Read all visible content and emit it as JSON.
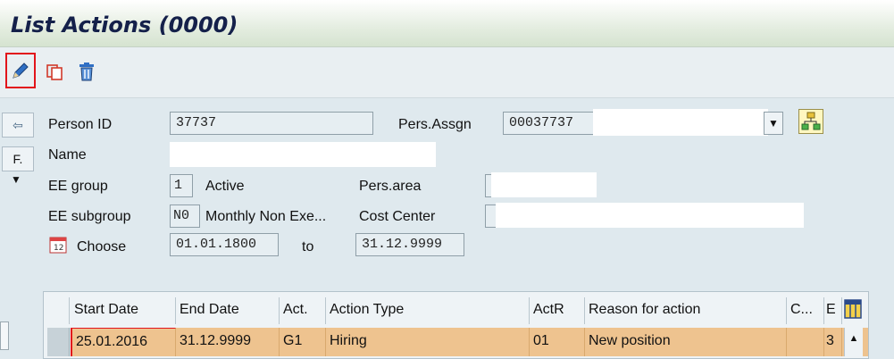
{
  "title": "List Actions (0000)",
  "toolbar": {
    "edit_icon": "pencil-icon",
    "copy_icon": "copy-icon",
    "delete_icon": "trash-icon"
  },
  "left_strip": {
    "back_icon": "back-arrow-icon",
    "f_label": "F.",
    "dropdown_icon": "triangle-down-icon"
  },
  "form": {
    "person_id_label": "Person ID",
    "person_id_value": "37737",
    "pers_assgn_label": "Pers.Assgn",
    "pers_assgn_value": "00037737",
    "name_label": "Name",
    "ee_group_label": "EE group",
    "ee_group_value": "1",
    "ee_group_text": "Active",
    "pers_area_label": "Pers.area",
    "ee_subgroup_label": "EE subgroup",
    "ee_subgroup_value": "N0",
    "ee_subgroup_text": "Monthly Non Exe...",
    "cost_center_label": "Cost Center",
    "choose_label": "Choose",
    "from_date": "01.01.1800",
    "to_label": "to",
    "to_date": "31.12.9999"
  },
  "table": {
    "columns": [
      "Start Date",
      "End Date",
      "Act.",
      "Action Type",
      "ActR",
      "Reason for action",
      "C...",
      "E"
    ],
    "rows": [
      [
        "25.01.2016",
        "31.12.9999",
        "G1",
        "Hiring",
        "01",
        "New position",
        "",
        "3"
      ]
    ]
  },
  "colors": {
    "title_text": "#14204a",
    "highlight_border": "#e2141b",
    "selected_row": "#eec38f"
  }
}
